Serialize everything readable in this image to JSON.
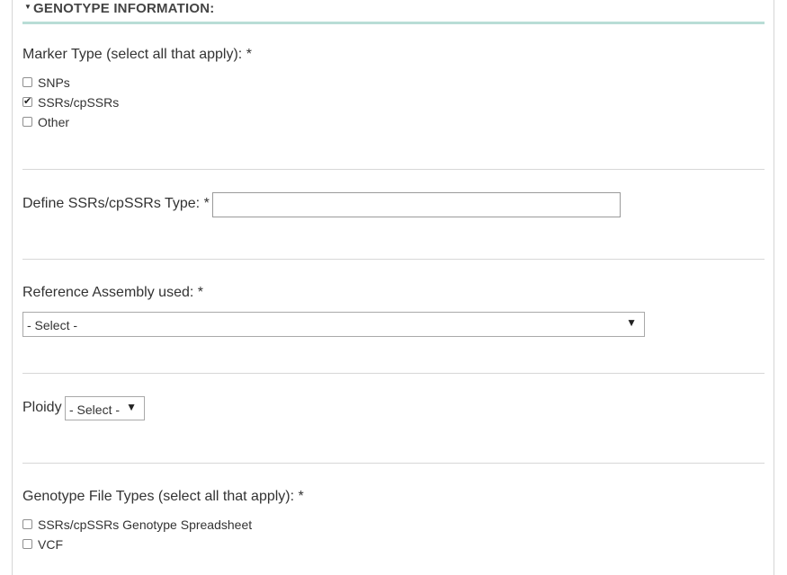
{
  "section": {
    "title": "GENOTYPE INFORMATION:"
  },
  "marker_type": {
    "label": "Marker Type (select all that apply): *",
    "options": [
      {
        "label": "SNPs",
        "checked": false
      },
      {
        "label": "SSRs/cpSSRs",
        "checked": true
      },
      {
        "label": "Other",
        "checked": false
      }
    ]
  },
  "ssr_type": {
    "label": "Define SSRs/cpSSRs Type: *",
    "value": ""
  },
  "reference_assembly": {
    "label": "Reference Assembly used: *",
    "selected": "- Select -"
  },
  "ploidy": {
    "label": "Ploidy",
    "selected": "- Select -"
  },
  "genotype_file_types": {
    "label": "Genotype File Types (select all that apply): *",
    "options": [
      {
        "label": "SSRs/cpSSRs Genotype Spreadsheet",
        "checked": false
      },
      {
        "label": "VCF",
        "checked": false
      }
    ]
  },
  "icons": {
    "collapse": "caret-down-icon",
    "dropdown": "triangle-down-icon"
  }
}
